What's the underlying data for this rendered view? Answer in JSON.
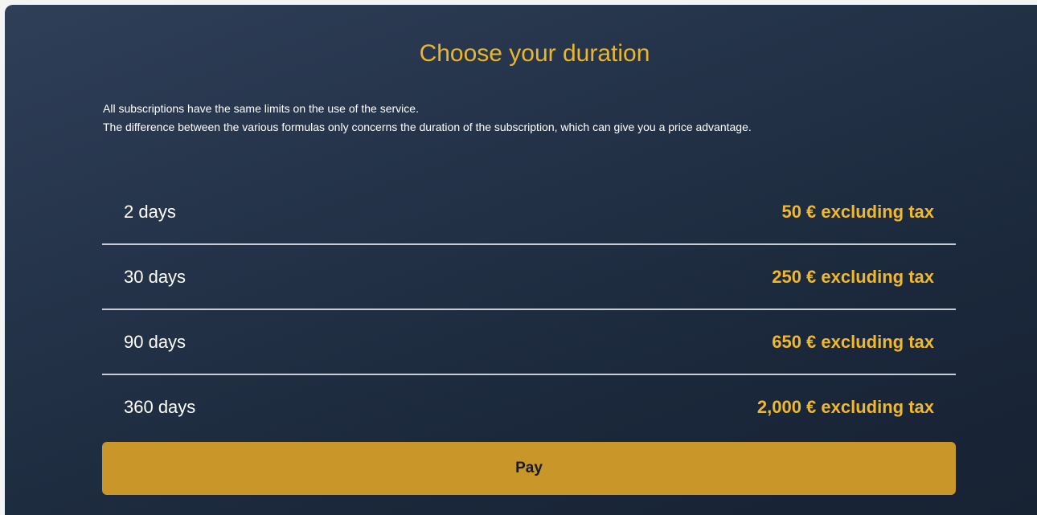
{
  "header": {
    "title": "Choose your duration"
  },
  "description": {
    "line1": "All subscriptions have the same limits on the use of the service.",
    "line2": "The difference between the various formulas only concerns the duration of the subscription, which can give you a price advantage."
  },
  "plans": [
    {
      "duration": "2 days",
      "price": "50 € excluding tax"
    },
    {
      "duration": "30 days",
      "price": "250 € excluding tax"
    },
    {
      "duration": "90 days",
      "price": "650 € excluding tax"
    },
    {
      "duration": "360 days",
      "price": "2,000 € excluding tax"
    }
  ],
  "actions": {
    "pay_label": "Pay"
  },
  "colors": {
    "accent": "#e9b72c",
    "button": "#c9962a",
    "panel": "#243349"
  }
}
